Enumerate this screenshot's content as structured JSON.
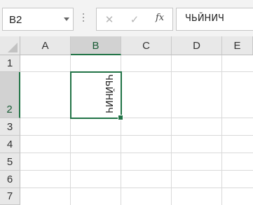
{
  "formula_bar": {
    "name_box": "B2",
    "cancel_symbol": "✕",
    "enter_symbol": "✓",
    "fx_label": "fx",
    "formula_value": "ЧЬЙНИЧ"
  },
  "sheet": {
    "columns": [
      "A",
      "B",
      "C",
      "D",
      "E"
    ],
    "rows": [
      "1",
      "2",
      "3",
      "4",
      "5",
      "6",
      "7"
    ],
    "selected_column": "B",
    "selected_row": "2",
    "active_cell": "B2",
    "active_cell_text": "ЧЬЙНИЧ"
  },
  "colors": {
    "accent": "#217346",
    "header_bg": "#e8e8e8",
    "selected_header_bg": "#d2d2d2"
  },
  "icons": [
    "name-box-dropdown-icon",
    "cancel-icon",
    "enter-icon",
    "function-icon",
    "select-all-icon"
  ]
}
